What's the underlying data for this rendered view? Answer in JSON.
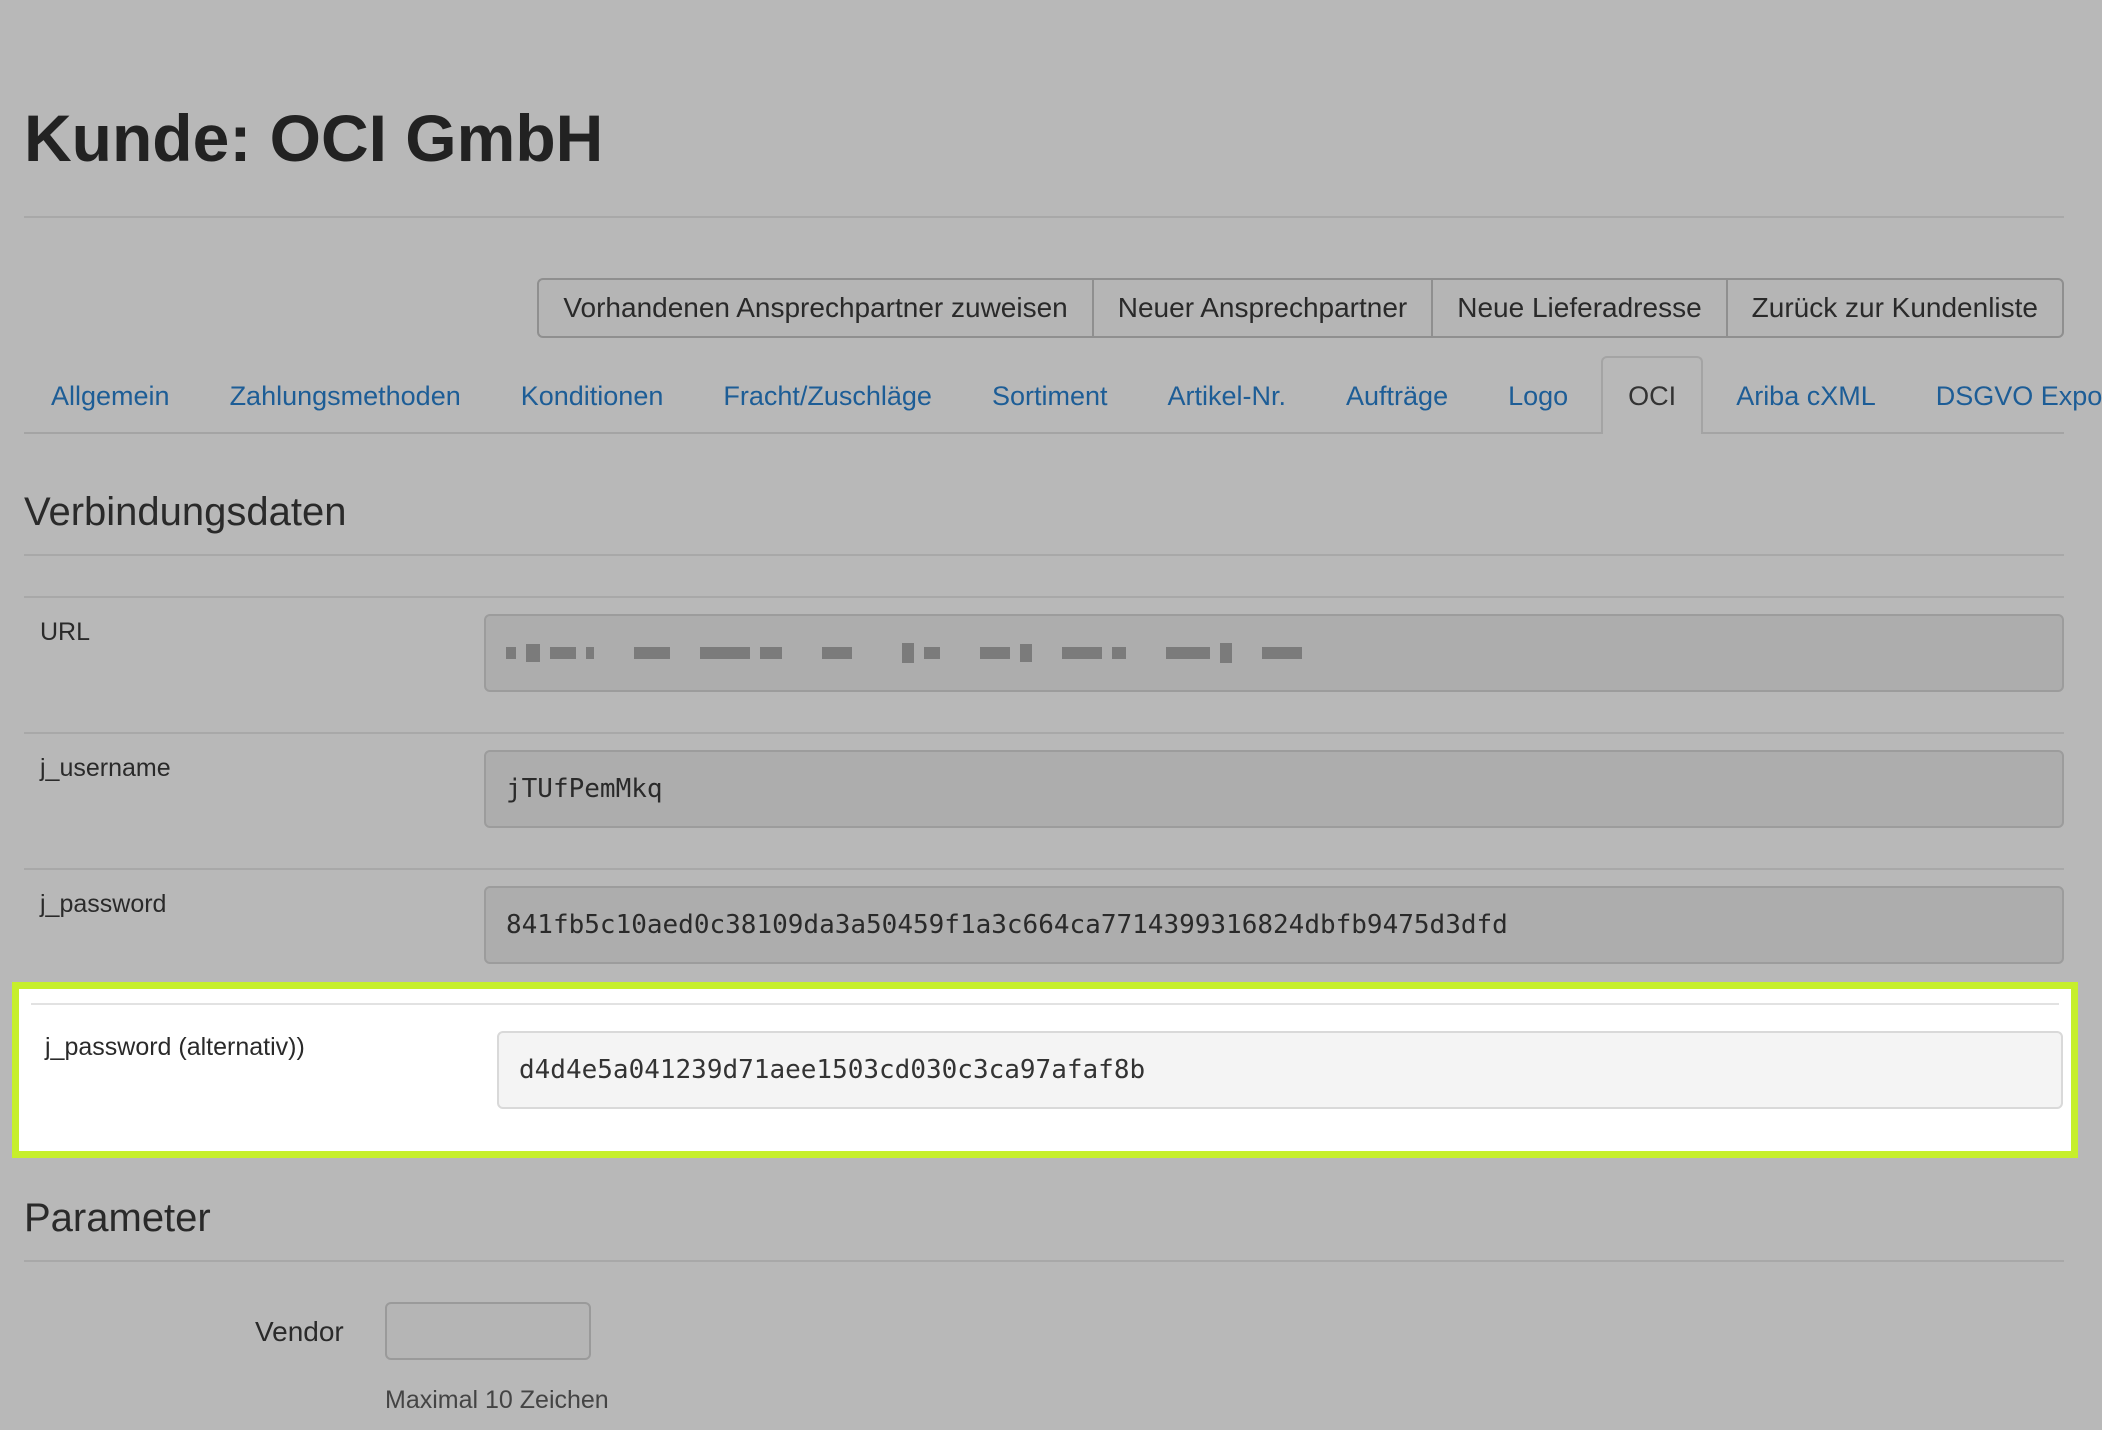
{
  "page_title": "Kunde: OCI GmbH",
  "actions": [
    {
      "label": "Vorhandenen Ansprechpartner zuweisen"
    },
    {
      "label": "Neuer Ansprechpartner"
    },
    {
      "label": "Neue Lieferadresse"
    },
    {
      "label": "Zurück zur Kundenliste"
    }
  ],
  "tabs": [
    {
      "label": "Allgemein"
    },
    {
      "label": "Zahlungsmethoden"
    },
    {
      "label": "Konditionen"
    },
    {
      "label": "Fracht/Zuschläge"
    },
    {
      "label": "Sortiment"
    },
    {
      "label": "Artikel-Nr."
    },
    {
      "label": "Aufträge"
    },
    {
      "label": "Logo"
    },
    {
      "label": "OCI"
    },
    {
      "label": "Ariba cXML"
    },
    {
      "label": "DSGVO Export"
    }
  ],
  "active_tab": "OCI",
  "connection": {
    "section_title": "Verbindungsdaten",
    "url_label": "URL",
    "url_value_obscured": true,
    "username_label": "j_username",
    "username_value": "jTUfPemMkq",
    "password_label": "j_password",
    "password_value": "841fb5c10aed0c38109da3a50459f1a3c664ca7714399316824dbfb9475d3dfd",
    "password_alt_label": "j_password (alternativ))",
    "password_alt_value": "d4d4e5a041239d71aee1503cd030c3ca97afaf8b"
  },
  "parameters": {
    "section_title": "Parameter",
    "vendor_label": "Vendor",
    "vendor_value": "",
    "vendor_help": "Maximal 10 Zeichen"
  },
  "colors": {
    "background": "#b8b8b8",
    "link": "#1d5d96",
    "highlight_border": "#c6ef2b"
  }
}
